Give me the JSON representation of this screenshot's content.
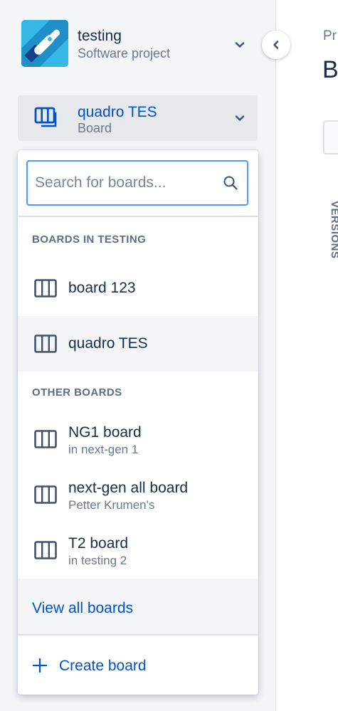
{
  "project": {
    "name": "testing",
    "type": "Software project",
    "avatar_color": "#36b7e6"
  },
  "board_switcher": {
    "name": "quadro TES",
    "subtitle": "Board"
  },
  "dropdown": {
    "search": {
      "placeholder": "Search for boards...",
      "value": ""
    },
    "sections": [
      {
        "heading": "BOARDS IN TESTING",
        "items": [
          {
            "title": "board 123",
            "selected": false
          },
          {
            "title": "quadro TES",
            "selected": true
          }
        ]
      },
      {
        "heading": "OTHER BOARDS",
        "items": [
          {
            "title": "NG1 board",
            "subtitle": "in next-gen 1"
          },
          {
            "title": "next-gen all board",
            "subtitle": "Petter Krumen's"
          },
          {
            "title": "T2 board",
            "subtitle": "in testing 2"
          }
        ]
      }
    ],
    "view_all_label": "View all boards",
    "create_label": "Create board"
  },
  "main": {
    "breadcrumb": "Pr",
    "title": "B",
    "versions_label": "VERSIONS"
  },
  "colors": {
    "link": "#0052cc",
    "text": "#172b4d",
    "subtle": "#6b778c",
    "focus": "#4c9aff",
    "sidebar_bg": "#f4f5f7"
  },
  "icons": {
    "project_avatar": "rocket-icon",
    "board": "board-columns-icon",
    "search": "search-icon",
    "chevron": "chevron-down-icon",
    "collapse": "chevron-left-icon",
    "create": "plus-icon"
  }
}
